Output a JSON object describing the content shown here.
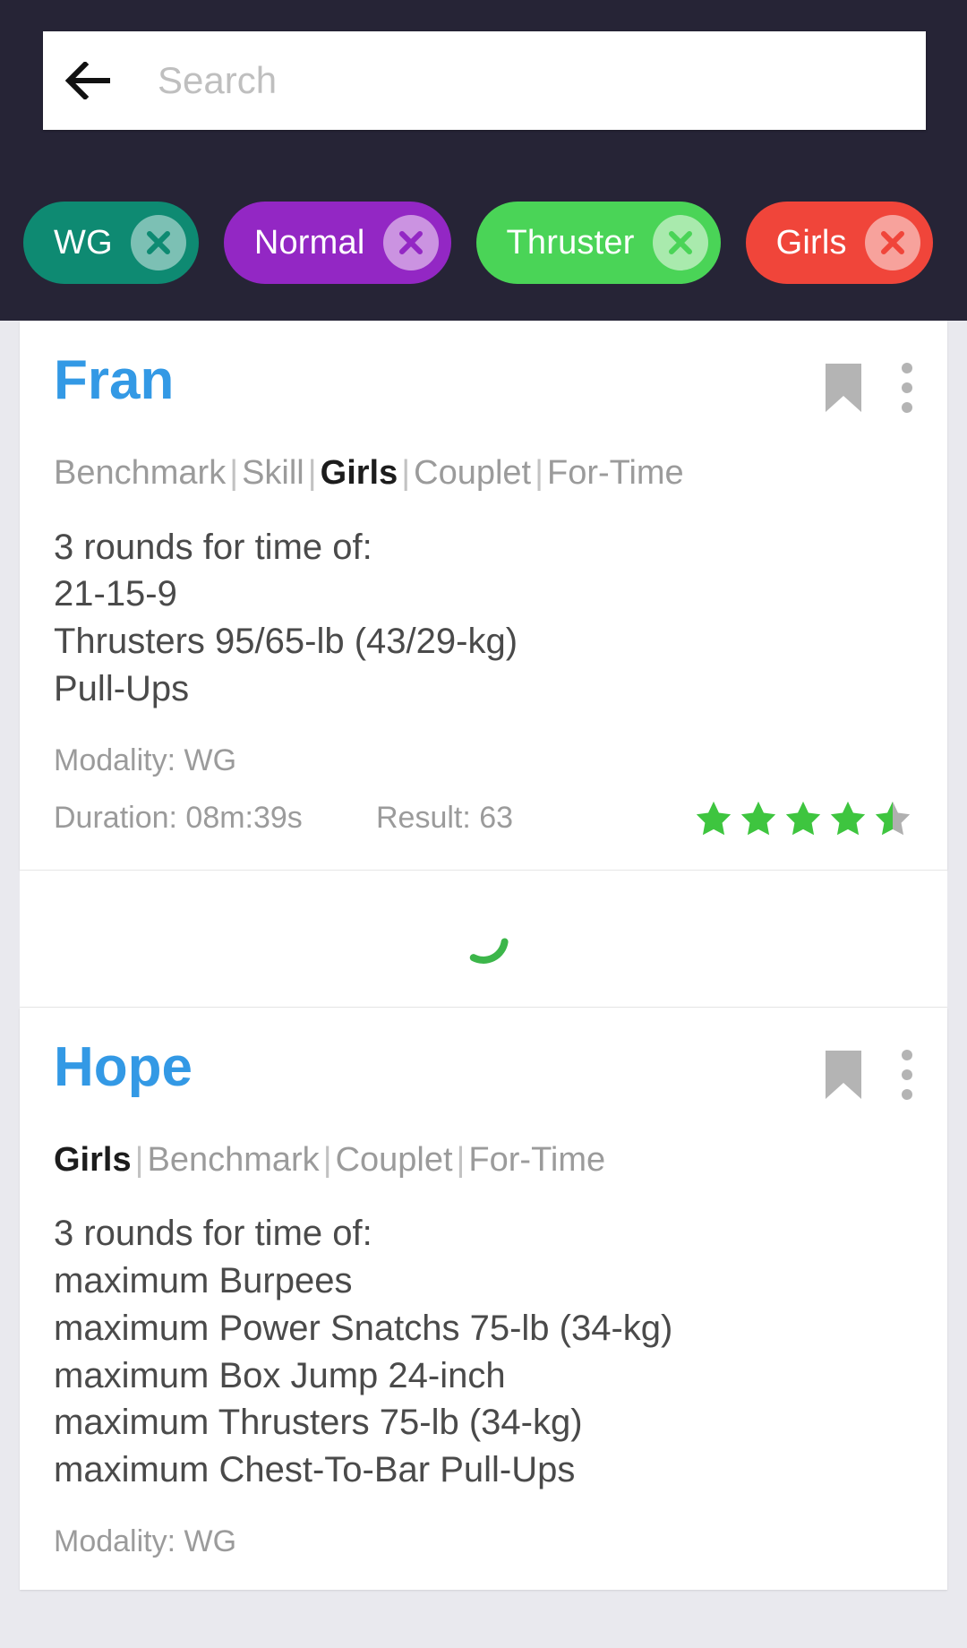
{
  "appbar": {
    "back_icon": "arrow-left-icon",
    "search": {
      "placeholder": "Search",
      "value": ""
    },
    "chips": [
      {
        "label": "WG",
        "bg": "#0e8a72",
        "close_bg": "#7cc0b4",
        "close_fg": "#0e8a72"
      },
      {
        "label": "Normal",
        "bg": "#9327c4",
        "close_bg": "#cb93e1",
        "close_fg": "#9327c4"
      },
      {
        "label": "Thruster",
        "bg": "#4ad457",
        "close_bg": "#a9eaad",
        "close_fg": "#4ad457"
      },
      {
        "label": "Girls",
        "bg": "#f0453a",
        "close_bg": "#f7a29c",
        "close_fg": "#f0453a"
      }
    ]
  },
  "colors": {
    "appbar_bg": "#262436",
    "title_blue": "#3399e5",
    "star_green": "#3ec53f",
    "star_empty": "#b0b0b0",
    "spinner_green": "#3cb64a",
    "list_bg": "#e9e9ee"
  },
  "cards": [
    {
      "title": "Fran",
      "bookmark_icon": "bookmark-icon",
      "menu_icon": "overflow-menu-icon",
      "tags": [
        {
          "text": "Benchmark",
          "active": false
        },
        {
          "text": "Skill",
          "active": false
        },
        {
          "text": "Girls",
          "active": true
        },
        {
          "text": "Couplet",
          "active": false
        },
        {
          "text": "For-Time",
          "active": false
        }
      ],
      "description": "3 rounds for time of:\n21-15-9\nThrusters 95/65-lb (43/29-kg)\nPull-Ups",
      "modality": "Modality: WG",
      "duration": "Duration: 08m:39s",
      "result": "Result: 63",
      "rating": 4.5,
      "rating_max": 5
    },
    {
      "title": "Hope",
      "bookmark_icon": "bookmark-icon",
      "menu_icon": "overflow-menu-icon",
      "tags": [
        {
          "text": "Girls",
          "active": true
        },
        {
          "text": "Benchmark",
          "active": false
        },
        {
          "text": "Couplet",
          "active": false
        },
        {
          "text": "For-Time",
          "active": false
        }
      ],
      "description": "3 rounds for time of:\nmaximum Burpees\nmaximum Power Snatchs 75-lb (34-kg)\nmaximum Box Jump 24-inch\nmaximum Thrusters 75-lb (34-kg)\nmaximum Chest-To-Bar Pull-Ups",
      "modality": "Modality: WG",
      "duration": "",
      "result": "",
      "rating": 0,
      "rating_max": 5
    }
  ],
  "loading": {
    "icon": "spinner-icon",
    "visible": true
  }
}
